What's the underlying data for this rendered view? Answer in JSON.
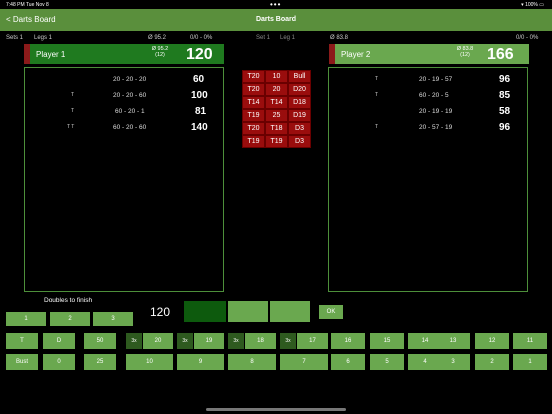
{
  "status": {
    "time": "7:48 PM",
    "date": "Tue Nov 8",
    "dots": "•••",
    "battery": "100%"
  },
  "nav": {
    "back": "< Darts Board",
    "title": "Darts Board"
  },
  "header": {
    "sets": "Sets 1",
    "legs": "Legs 1",
    "sets_mid": "Set 1",
    "legs_mid": "Leg 1",
    "p1_avg": "Ø 95.2",
    "p1_dart_stats": "0/0  -  0%",
    "p2_avg": "Ø 83.8",
    "p2_dart_stats": "0/0  -  0%"
  },
  "player1": {
    "name": "Player 1",
    "avg": "Ø 95.2",
    "darts": "(12)",
    "score": "120",
    "rows": [
      {
        "t": "",
        "darts": "20 - 20 - 20",
        "points": "60"
      },
      {
        "t": "T",
        "darts": "20 - 20 - 60",
        "points": "100"
      },
      {
        "t": "T",
        "darts": "60 - 20 - 1",
        "points": "81"
      },
      {
        "t": "T T",
        "darts": "60 - 20 - 60",
        "points": "140"
      }
    ]
  },
  "player2": {
    "name": "Player 2",
    "avg": "Ø 83.8",
    "darts": "(12)",
    "score": "166",
    "rows": [
      {
        "t": "T",
        "darts": "20 - 19 - 57",
        "points": "96"
      },
      {
        "t": "T",
        "darts": "60 - 20 - 5",
        "points": "85"
      },
      {
        "t": "",
        "darts": "20 - 19 - 19",
        "points": "58"
      },
      {
        "t": "T",
        "darts": "20 - 57 - 19",
        "points": "96"
      }
    ]
  },
  "checkout": [
    [
      "T20",
      "10",
      "Bull"
    ],
    [
      "T20",
      "20",
      "D20"
    ],
    [
      "T14",
      "T14",
      "D18"
    ],
    [
      "T19",
      "25",
      "D19"
    ],
    [
      "T20",
      "T18",
      "D3"
    ],
    [
      "T19",
      "T19",
      "D3"
    ]
  ],
  "doubles": {
    "label": "Doubles to finish",
    "opts": [
      "1",
      "2",
      "3"
    ]
  },
  "entry": {
    "value": "120",
    "ok": "OK"
  },
  "keys": {
    "t": "T",
    "d": "D",
    "bust": "Bust",
    "zero": "0",
    "fifty": "50",
    "twentyfive": "25",
    "x3": "3x",
    "row1": [
      "20",
      "19",
      "18",
      "17",
      "16",
      "15",
      "14",
      "13",
      "12",
      "11"
    ],
    "row2": [
      "10",
      "9",
      "8",
      "7",
      "6",
      "5",
      "4",
      "3",
      "2",
      "1"
    ]
  }
}
